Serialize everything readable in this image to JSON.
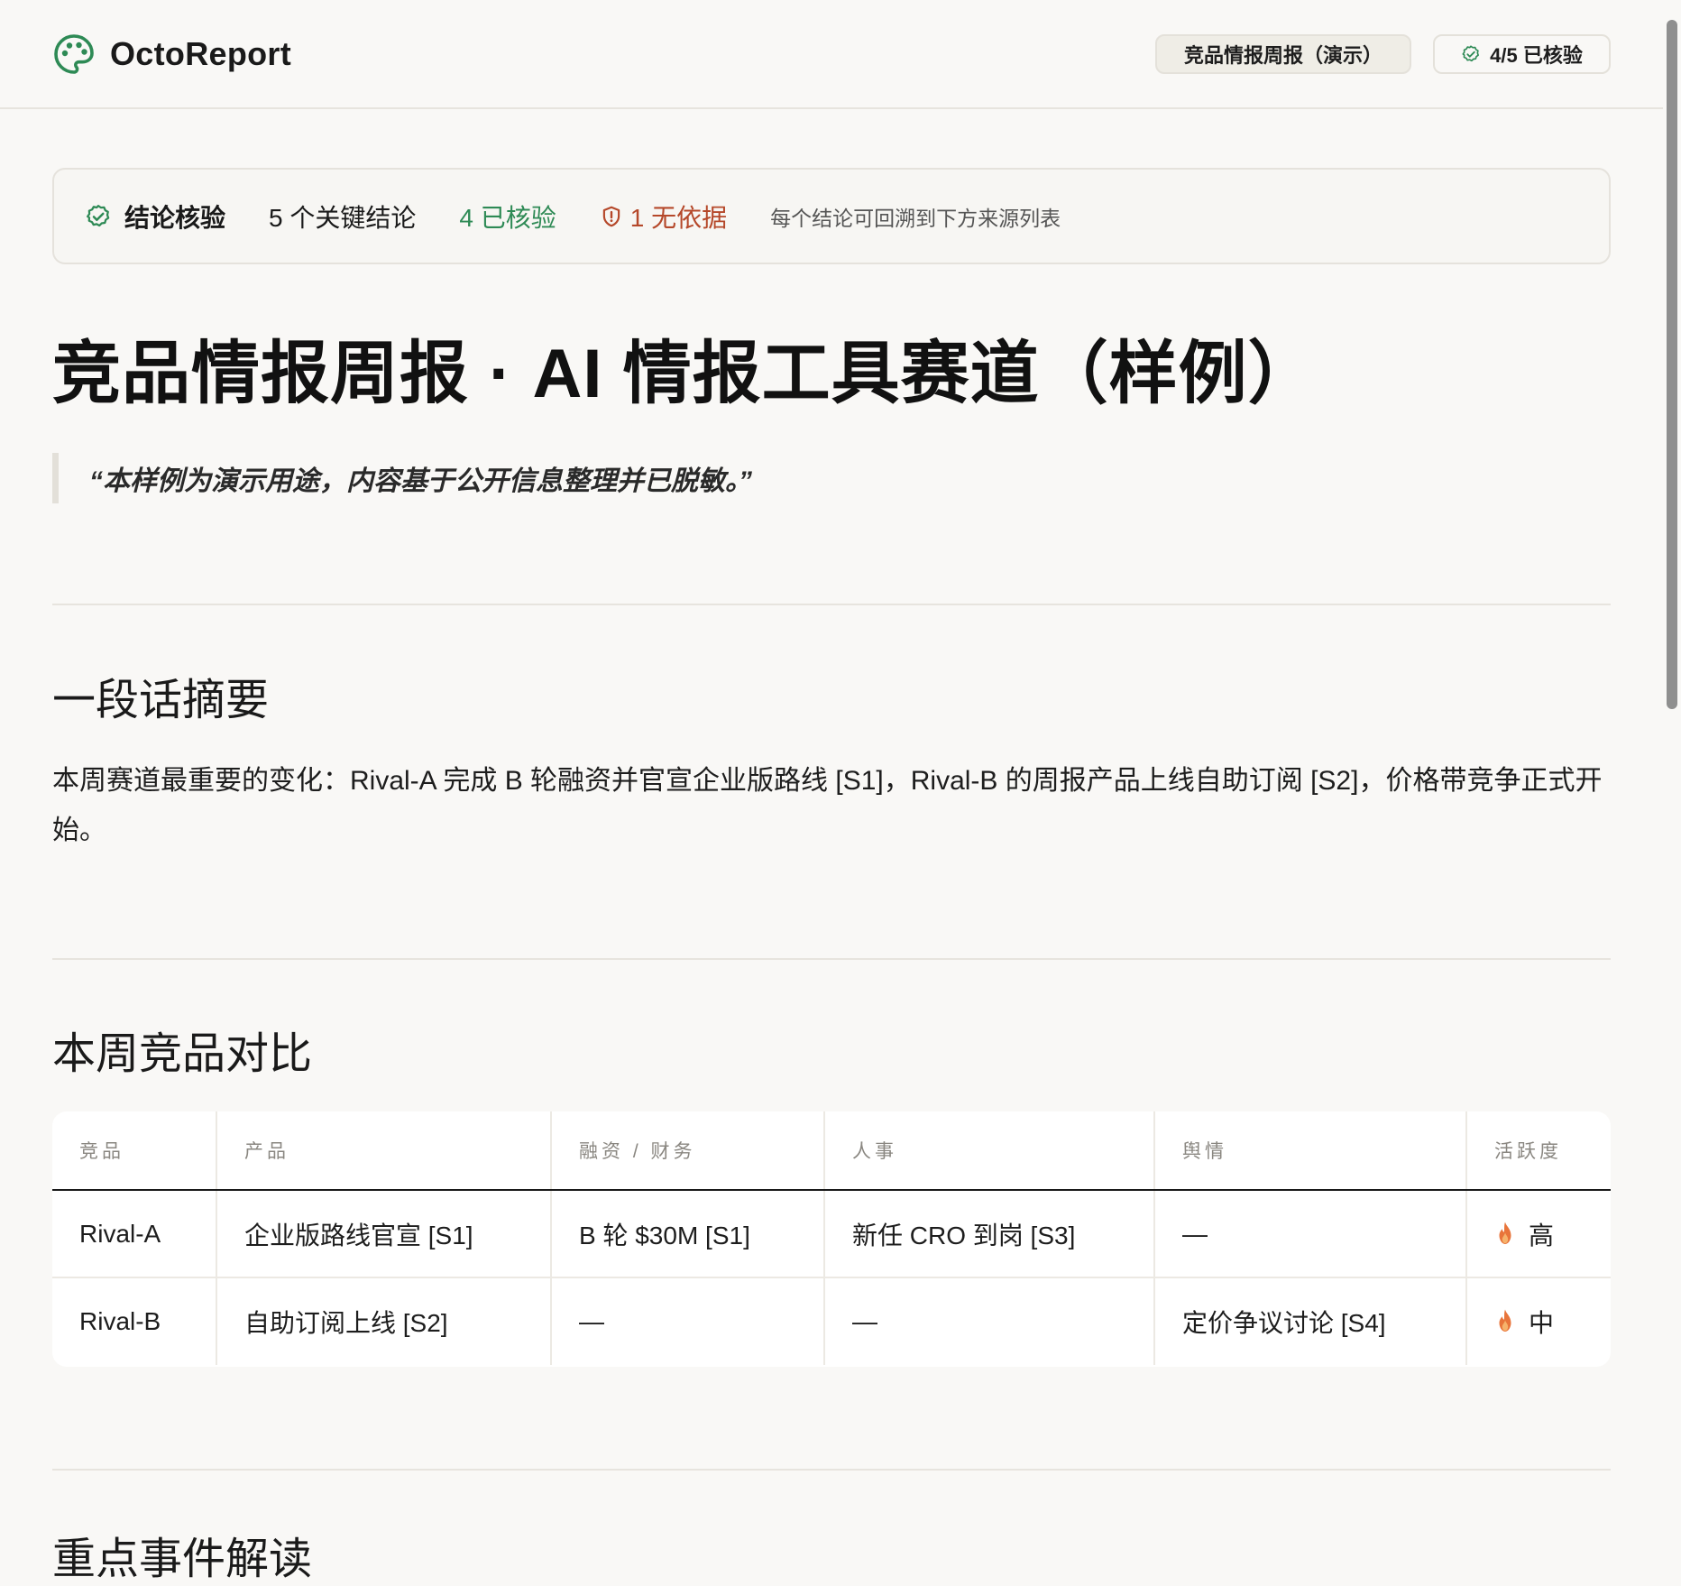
{
  "header": {
    "brand": "OctoReport",
    "report_pill": "竞品情报周报（演示）",
    "verified_pill": "4/5 已核验"
  },
  "verify": {
    "title": "结论核验",
    "count": "5 个关键结论",
    "verified": "4 已核验",
    "unsupported": "1 无依据",
    "hint": "每个结论可回溯到下方来源列表"
  },
  "page": {
    "title": "竞品情报周报 · AI 情报工具赛道（样例）",
    "quote": "“本样例为演示用途，内容基于公开信息整理并已脱敏。”"
  },
  "summary": {
    "heading": "一段话摘要",
    "text": "本周赛道最重要的变化：Rival-A 完成 B 轮融资并官宣企业版路线 [S1]，Rival-B 的周报产品上线自助订阅 [S2]，价格带竞争正式开始。"
  },
  "compare": {
    "heading": "本周竞品对比",
    "columns": [
      "竞品",
      "产品",
      "融资 / 财务",
      "人事",
      "舆情",
      "活跃度"
    ],
    "rows": [
      [
        "Rival-A",
        "企业版路线官宣 [S1]",
        "B 轮 $30M [S1]",
        "新任 CRO 到岗 [S3]",
        "—",
        "高"
      ],
      [
        "Rival-B",
        "自助订阅上线 [S2]",
        "—",
        "—",
        "定价争议讨论 [S4]",
        "中"
      ]
    ]
  },
  "next_section": {
    "heading": "重点事件解读"
  },
  "colors": {
    "accent_green": "#2e8a55",
    "warn_red": "#b5482a",
    "fire_orange": "#e8743a",
    "background": "#f9f8f6"
  },
  "icons": [
    "palette-logo-icon",
    "check-circle-icon",
    "shield-alert-icon",
    "fire-icon"
  ]
}
